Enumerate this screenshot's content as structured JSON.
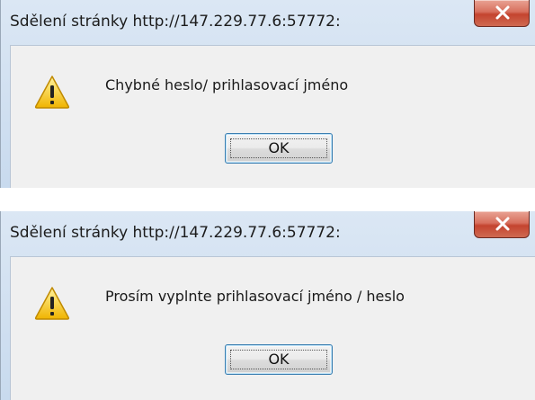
{
  "dialogs": [
    {
      "title": "Sdělení stránky http://147.229.77.6:57772:",
      "message": "Chybné heslo/ prihlasovací jméno",
      "ok_label": "OK",
      "icon": "warning-icon",
      "close_icon": "close-icon"
    },
    {
      "title": "Sdělení stránky http://147.229.77.6:57772:",
      "message": "Prosím vyplnte prihlasovací jméno / heslo",
      "ok_label": "OK",
      "icon": "warning-icon",
      "close_icon": "close-icon"
    }
  ],
  "colors": {
    "frame": "#c8daee",
    "content_bg": "#f0f0f0",
    "close_red": "#c4442f",
    "ok_border": "#3c7fb1",
    "warning_yellow": "#f4c430"
  }
}
